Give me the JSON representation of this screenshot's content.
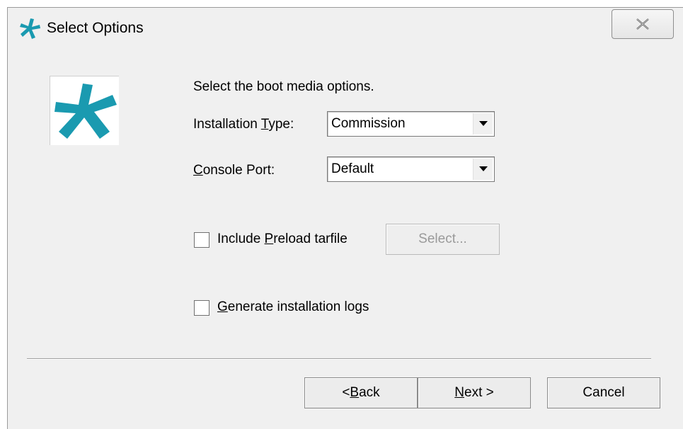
{
  "window": {
    "title": "Select Options",
    "close_icon": "close-x-icon",
    "app_icon": "asterisk-logo-icon",
    "brand_color": "#1a9ab0"
  },
  "content": {
    "instruction": "Select the boot media options.",
    "installation_type": {
      "label_pre": "Installation ",
      "label_mnemonic": "T",
      "label_post": "ype:",
      "value": "Commission"
    },
    "console_port": {
      "label_mnemonic": "C",
      "label_post": "onsole Port:",
      "value": "Default"
    },
    "include_preload": {
      "label_pre": "Include ",
      "label_mnemonic": "P",
      "label_post": "reload tarfile",
      "checked": false
    },
    "select_button": "Select...",
    "generate_logs": {
      "label_mnemonic": "G",
      "label_post": "enerate installation logs",
      "checked": false
    }
  },
  "buttons": {
    "back_pre": "< ",
    "back_mnemonic": "B",
    "back_post": "ack",
    "next_mnemonic": "N",
    "next_post": "ext >",
    "cancel": "Cancel"
  }
}
